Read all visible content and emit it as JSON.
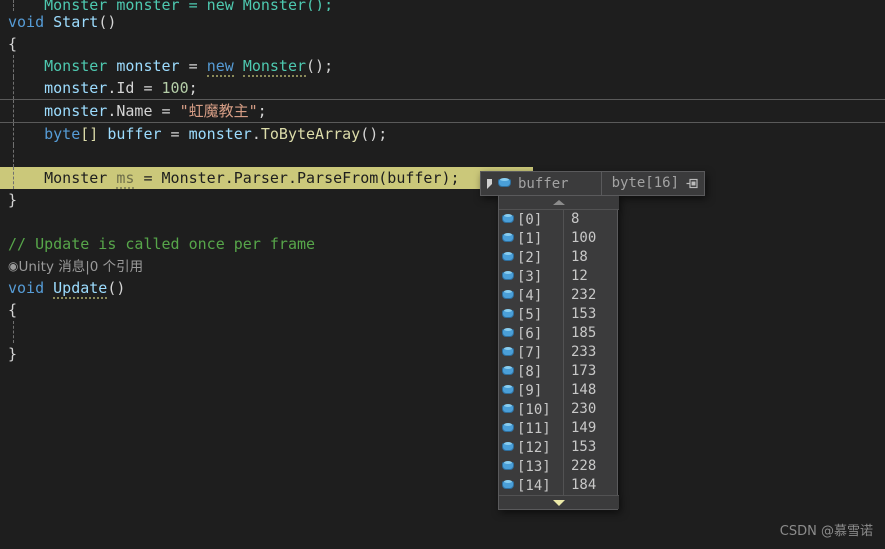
{
  "editor": {
    "background_color": "#1e1e1e",
    "foreground_color": "#d4d4d4",
    "exec_highlight_color": "#cbc87a",
    "lines": {
      "l0_clipped": "    Monster monster = new Monster();",
      "l1_void": "void",
      "l1_start": "Start",
      "l1_parens": "()",
      "l2_brace": "{",
      "l3_type": "Monster",
      "l3_ident": "monster",
      "l3_eq": " = ",
      "l3_new": "new",
      "l3_ctor": "Monster",
      "l3_tail": "();",
      "l4_obj": "monster",
      "l4_dot": ".",
      "l4_prop": "Id",
      "l4_eq": " = ",
      "l4_num": "100",
      "l4_semi": ";",
      "l5_obj": "monster",
      "l5_dot": ".",
      "l5_prop": "Name",
      "l5_eq": " = ",
      "l5_str": "\"虹魔教主\"",
      "l5_semi": ";",
      "l6_type": "byte",
      "l6_brackets": "[]",
      "l6_ident": "buffer",
      "l6_eq": " = ",
      "l6_obj": "monster",
      "l6_dot": ".",
      "l6_method": "ToByteArray",
      "l6_tail": "();",
      "l8_type": "Monster",
      "l8_var": "ms",
      "l8_eq": " = ",
      "l8_expr": "Monster.Parser.ParseFrom(buffer);",
      "l9_brace": "}",
      "l11_comment": "// Update is called once per frame",
      "l13_void": "void",
      "l13_update": "Update",
      "l13_parens": "()",
      "l14_brace": "{",
      "l15_brace": "}"
    },
    "codelens": {
      "icon": "unity-message-icon",
      "text": "Unity 消息|0 个引用"
    }
  },
  "datatip": {
    "collapse_icon": "triangle-collapse-icon",
    "field_icon": "field-icon",
    "name": "buffer",
    "type": "byte[16]",
    "pin_icon": "pin-icon",
    "scroll_up_icon": "scroll-up-arrow-icon",
    "scroll_down_icon": "scroll-down-arrow-icon",
    "rows": [
      {
        "name": "[0]",
        "value": "8"
      },
      {
        "name": "[1]",
        "value": "100"
      },
      {
        "name": "[2]",
        "value": "18"
      },
      {
        "name": "[3]",
        "value": "12"
      },
      {
        "name": "[4]",
        "value": "232"
      },
      {
        "name": "[5]",
        "value": "153"
      },
      {
        "name": "[6]",
        "value": "185"
      },
      {
        "name": "[7]",
        "value": "233"
      },
      {
        "name": "[8]",
        "value": "173"
      },
      {
        "name": "[9]",
        "value": "148"
      },
      {
        "name": "[10]",
        "value": "230"
      },
      {
        "name": "[11]",
        "value": "149"
      },
      {
        "name": "[12]",
        "value": "153"
      },
      {
        "name": "[13]",
        "value": "228"
      },
      {
        "name": "[14]",
        "value": "184"
      }
    ]
  },
  "watermark": {
    "text": "CSDN @慕雪诺"
  }
}
